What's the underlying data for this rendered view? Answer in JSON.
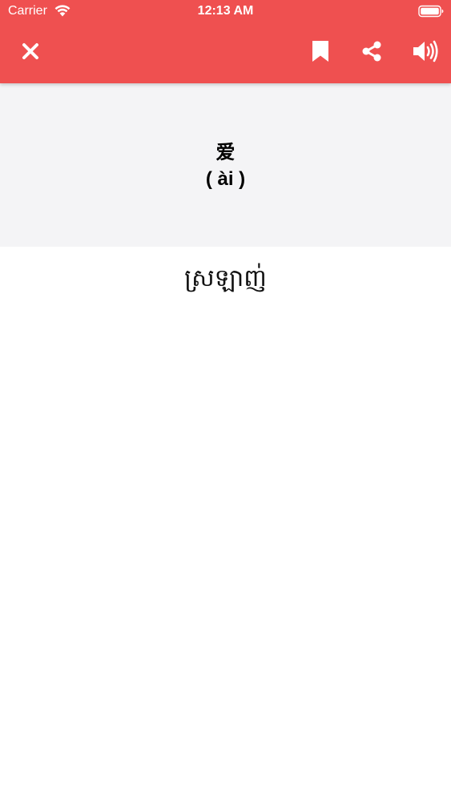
{
  "status_bar": {
    "carrier": "Carrier",
    "time": "12:13 AM",
    "icons": [
      "wifi-icon",
      "battery-icon"
    ]
  },
  "toolbar": {
    "icons": [
      "close-icon",
      "bookmark-icon",
      "share-icon",
      "speaker-icon"
    ]
  },
  "word": {
    "hanzi": "爱",
    "pinyin": "( ài )"
  },
  "translation": {
    "text": "ស្រឡាញ់"
  },
  "colors": {
    "accent": "#ef5050",
    "panel_background": "#f4f4f6",
    "page_background": "#ffffff",
    "icon": "#ffffff"
  }
}
